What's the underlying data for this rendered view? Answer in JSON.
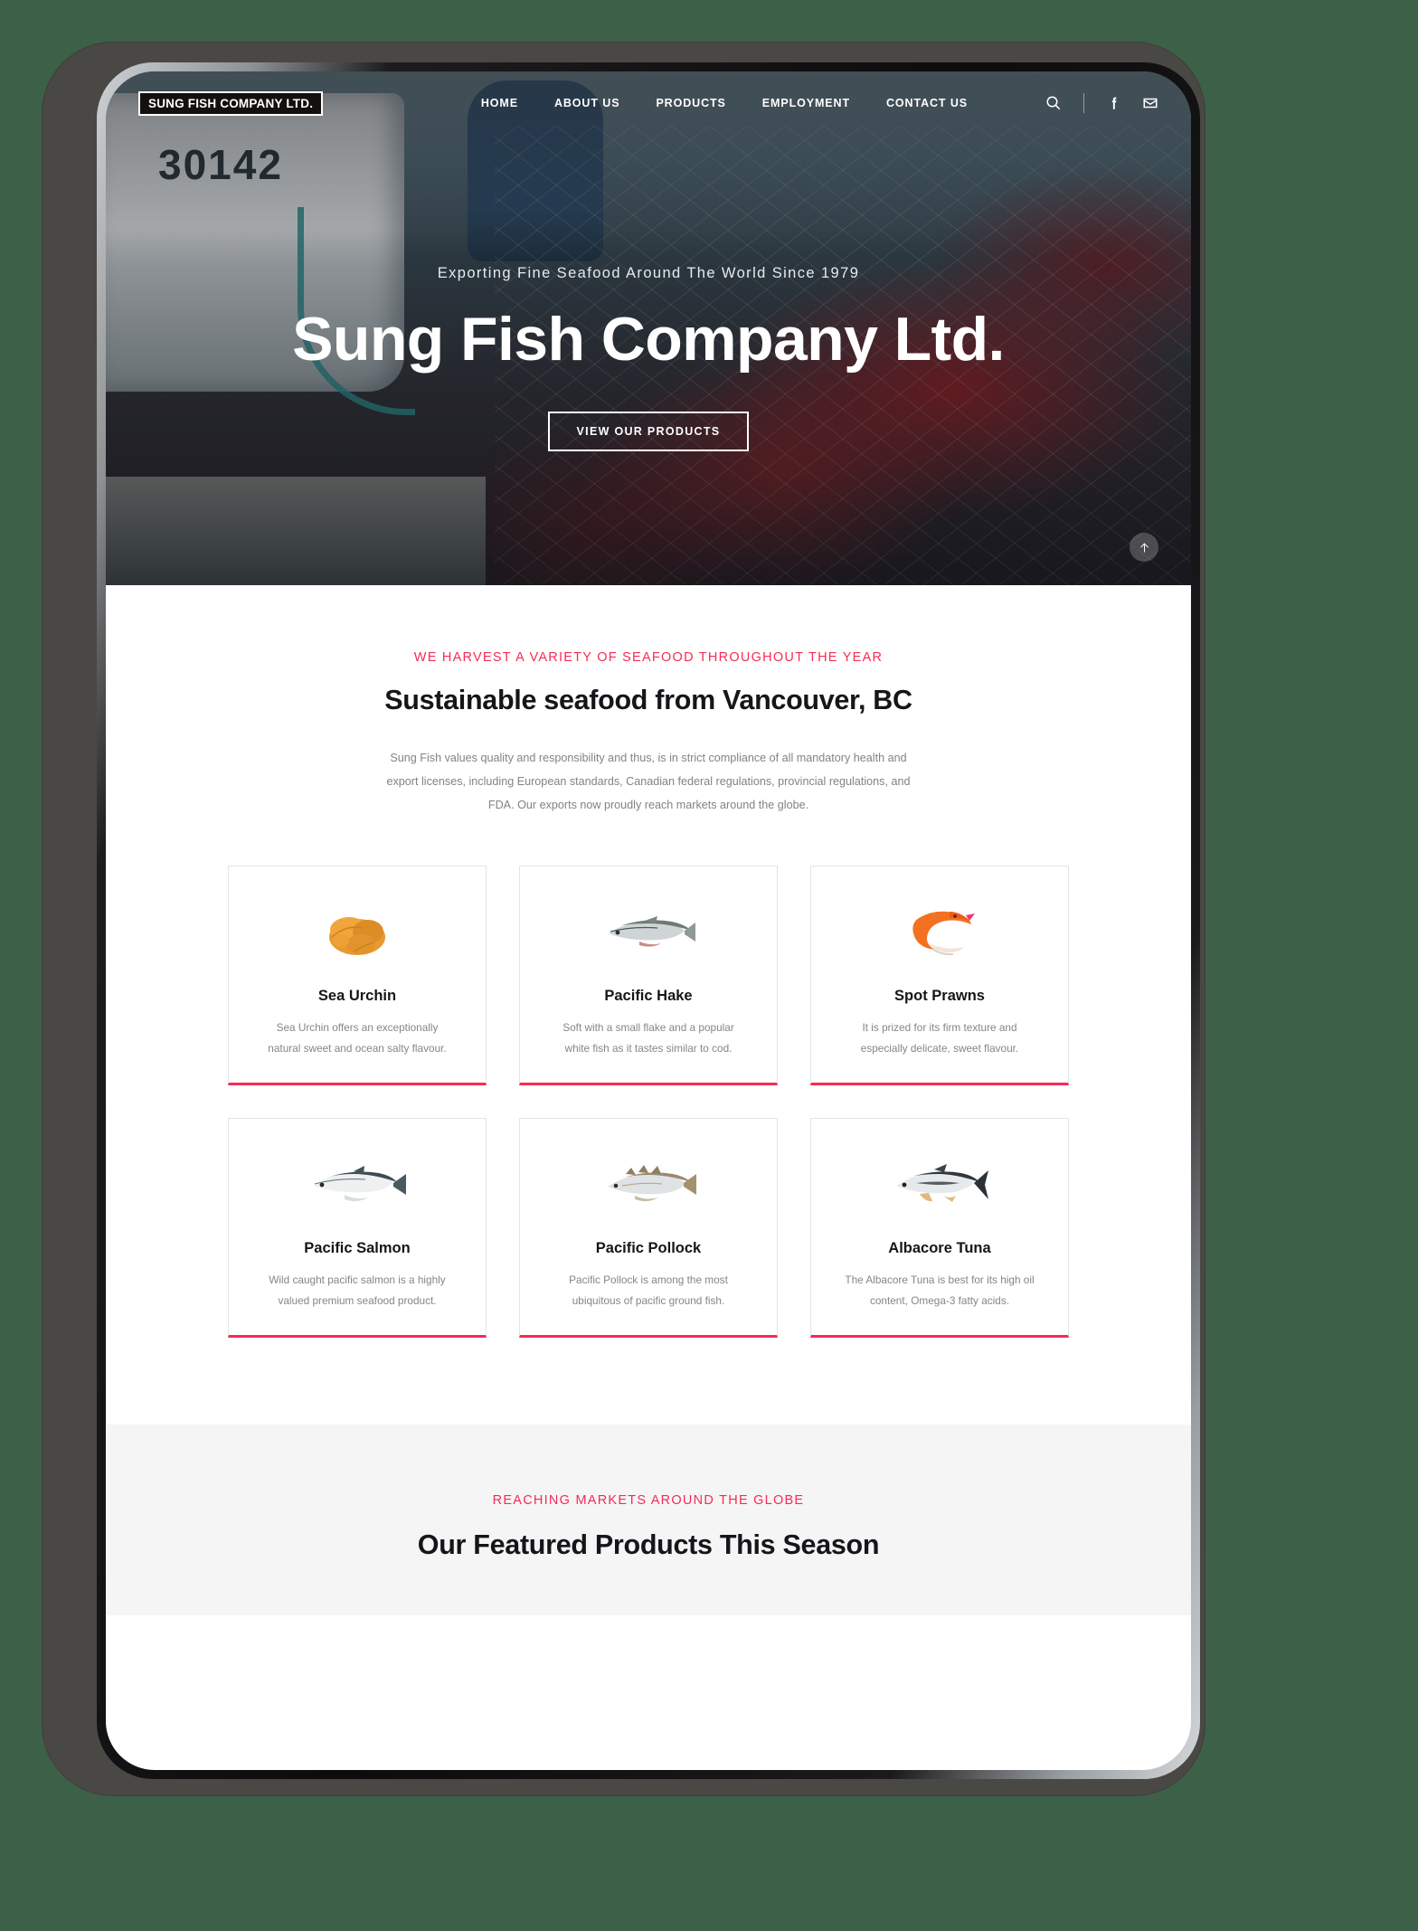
{
  "brand": {
    "accent": "#f62b54",
    "dark": "#16161a",
    "page_background": "#3d6148"
  },
  "nav": {
    "logo": "SUNG FISH COMPANY LTD.",
    "links": [
      {
        "label": "HOME"
      },
      {
        "label": "ABOUT US"
      },
      {
        "label": "PRODUCTS"
      },
      {
        "label": "EMPLOYMENT"
      },
      {
        "label": "CONTACT US"
      }
    ],
    "tools": [
      {
        "icon": "search-icon"
      },
      {
        "icon": "facebook-icon"
      },
      {
        "icon": "envelope-icon"
      }
    ]
  },
  "hero": {
    "eyebrow": "Exporting Fine Seafood Around The World Since 1979",
    "title": "Sung Fish Company Ltd.",
    "cta_label": "VIEW OUR PRODUCTS",
    "boat_number": "30142",
    "scroll_top_icon": "arrow-up-icon"
  },
  "products_section": {
    "eyebrow": "WE HARVEST A VARIETY OF SEAFOOD THROUGHOUT THE YEAR",
    "title": "Sustainable seafood from Vancouver, BC",
    "intro": "Sung Fish values quality and responsibility and thus, is in strict compliance of all mandatory health and export licenses, including European standards, Canadian federal regulations, provincial regulations, and FDA. Our exports now proudly reach markets around the globe.",
    "cards": [
      {
        "icon": "sea-urchin-icon",
        "title": "Sea Urchin",
        "desc": "Sea Urchin offers an exceptionally natural sweet and ocean salty flavour."
      },
      {
        "icon": "pacific-hake-icon",
        "title": "Pacific Hake",
        "desc": "Soft with a small flake and a popular white fish as it tastes similar to cod."
      },
      {
        "icon": "spot-prawn-icon",
        "title": "Spot Prawns",
        "desc": "It is prized for its firm texture and especially delicate, sweet flavour."
      },
      {
        "icon": "pacific-salmon-icon",
        "title": "Pacific Salmon",
        "desc": "Wild caught pacific salmon is a highly valued premium seafood product."
      },
      {
        "icon": "pacific-pollock-icon",
        "title": "Pacific Pollock",
        "desc": "Pacific Pollock is among the most ubiquitous of pacific ground fish."
      },
      {
        "icon": "albacore-tuna-icon",
        "title": "Albacore Tuna",
        "desc": "The Albacore Tuna is best for its high oil content, Omega-3 fatty acids."
      }
    ]
  },
  "featured_section": {
    "eyebrow": "REACHING MARKETS AROUND THE GLOBE",
    "title": "Our Featured Products This Season"
  }
}
